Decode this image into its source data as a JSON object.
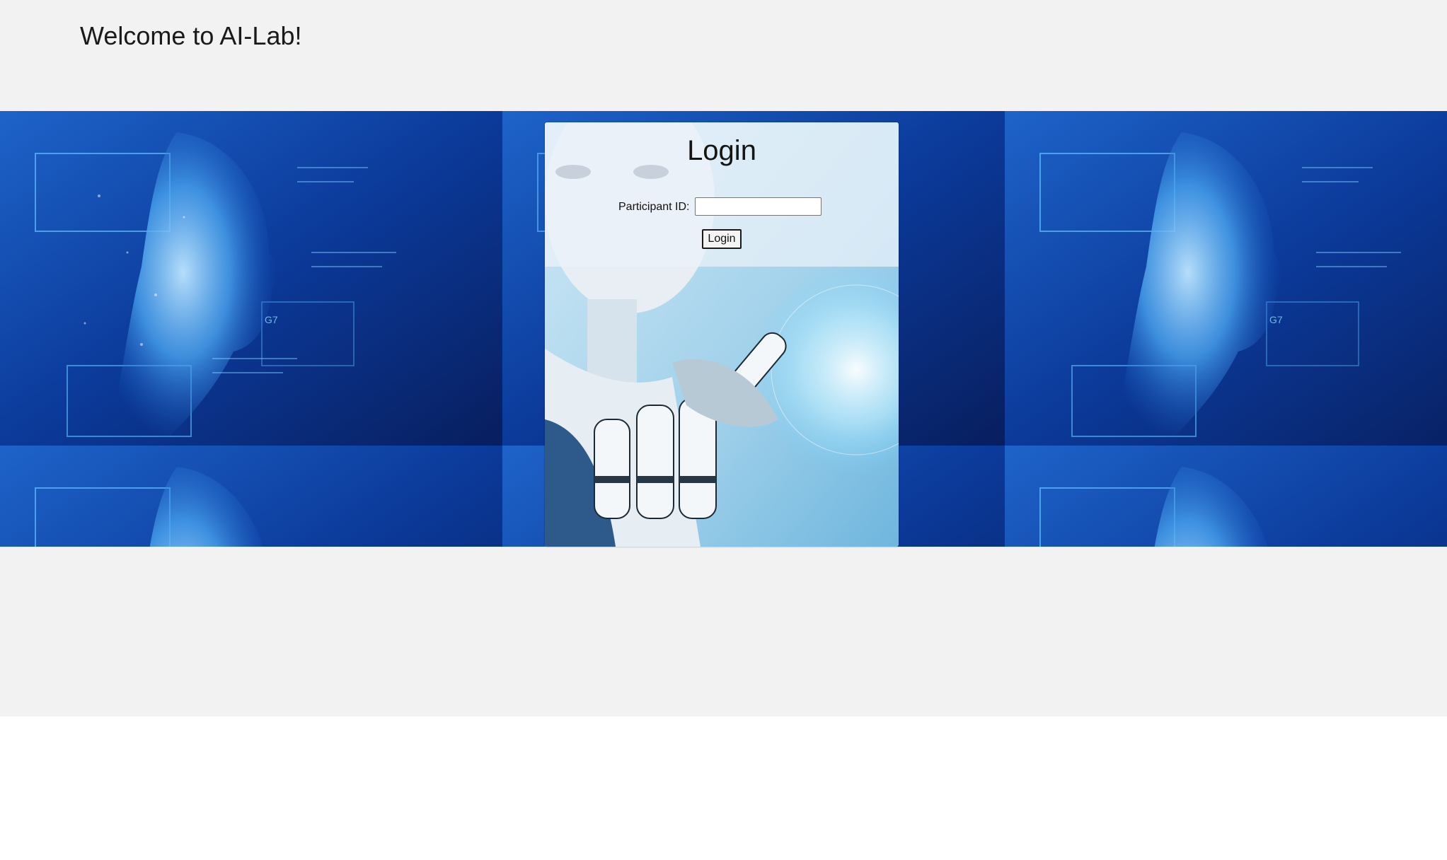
{
  "header": {
    "title": "Welcome to AI-Lab!"
  },
  "login": {
    "heading": "Login",
    "participant_label": "Participant ID:",
    "participant_value": "",
    "button_label": "Login"
  },
  "banner": {
    "image": "ai-face-tech-background"
  },
  "card_image": "robot-illustration",
  "colors": {
    "page_bg": "#f2f2f2",
    "banner_blue": "#0a2a7a",
    "accent_cyan": "#4fc3f7",
    "card_overlay": "#ebf3fa"
  }
}
